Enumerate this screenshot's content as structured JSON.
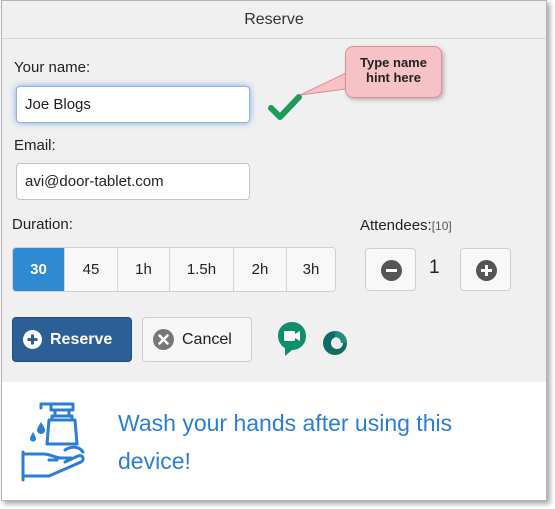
{
  "window": {
    "title": "Reserve"
  },
  "form": {
    "name_label": "Your name:",
    "name_value": "Joe Blogs",
    "name_status_icon": "checkmark-icon",
    "email_label": "Email:",
    "email_value": "avi@door-tablet.com"
  },
  "tooltip": {
    "line1": "Type name",
    "line2": "hint here"
  },
  "duration": {
    "label": "Duration:",
    "options": [
      "30",
      "45",
      "1h",
      "1.5h",
      "2h",
      "3h"
    ],
    "selected": "30"
  },
  "attendees": {
    "label": "Attendees:",
    "max": "[10]",
    "count": "1",
    "decrement_icon": "minus-circle-icon",
    "increment_icon": "plus-circle-icon"
  },
  "actions": {
    "reserve_label": "Reserve",
    "cancel_label": "Cancel",
    "reserve_icon": "plus-circle-icon",
    "cancel_icon": "close-circle-icon"
  },
  "integrations": [
    "google-meet-icon",
    "office365-icon"
  ],
  "banner": {
    "text_line1": "Wash your hands after using this",
    "text_line2": "device!",
    "icon": "hand-wash-icon"
  },
  "colors": {
    "accent": "#2f8ad1",
    "primary_button": "#2d5f97",
    "valid_check": "#1e9a5a",
    "tooltip_bg": "#f7c2c5",
    "banner_text": "#2a7fd4"
  }
}
